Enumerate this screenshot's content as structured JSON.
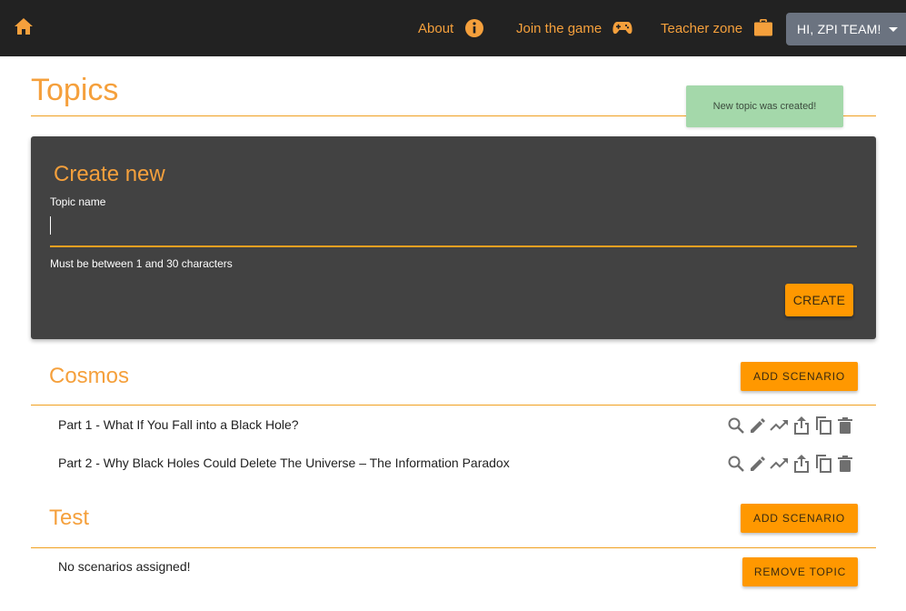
{
  "nav": {
    "about_label": "About",
    "join_label": "Join the game",
    "teacher_label": "Teacher zone",
    "user_label": "HI, ZPI TEAM!"
  },
  "page": {
    "title": "Topics"
  },
  "toast": {
    "message": "New topic was created!"
  },
  "create": {
    "heading": "Create new",
    "field_label": "Topic name",
    "field_value": "",
    "hint": "Must be between 1 and 30 characters",
    "button_label": "CREATE"
  },
  "topics": [
    {
      "name": "Cosmos",
      "add_label": "ADD SCENARIO",
      "scenarios": [
        "Part 1 - What If You Fall into a Black Hole?",
        "Part 2 - Why Black Holes Could Delete The Universe – The Information Paradox"
      ]
    },
    {
      "name": "Test",
      "add_label": "ADD SCENARIO",
      "empty_text": "No scenarios assigned!",
      "remove_label": "REMOVE TOPIC"
    }
  ],
  "icons": [
    "home-icon",
    "info-icon",
    "gamepad-icon",
    "briefcase-icon",
    "search-icon",
    "edit-icon",
    "trending-icon",
    "share-icon",
    "copy-icon",
    "delete-icon"
  ],
  "colors": {
    "accent": "#f5a03c",
    "button": "#ff9800",
    "navbar": "#222222",
    "card": "#424242",
    "toast": "#a4d8aa"
  }
}
